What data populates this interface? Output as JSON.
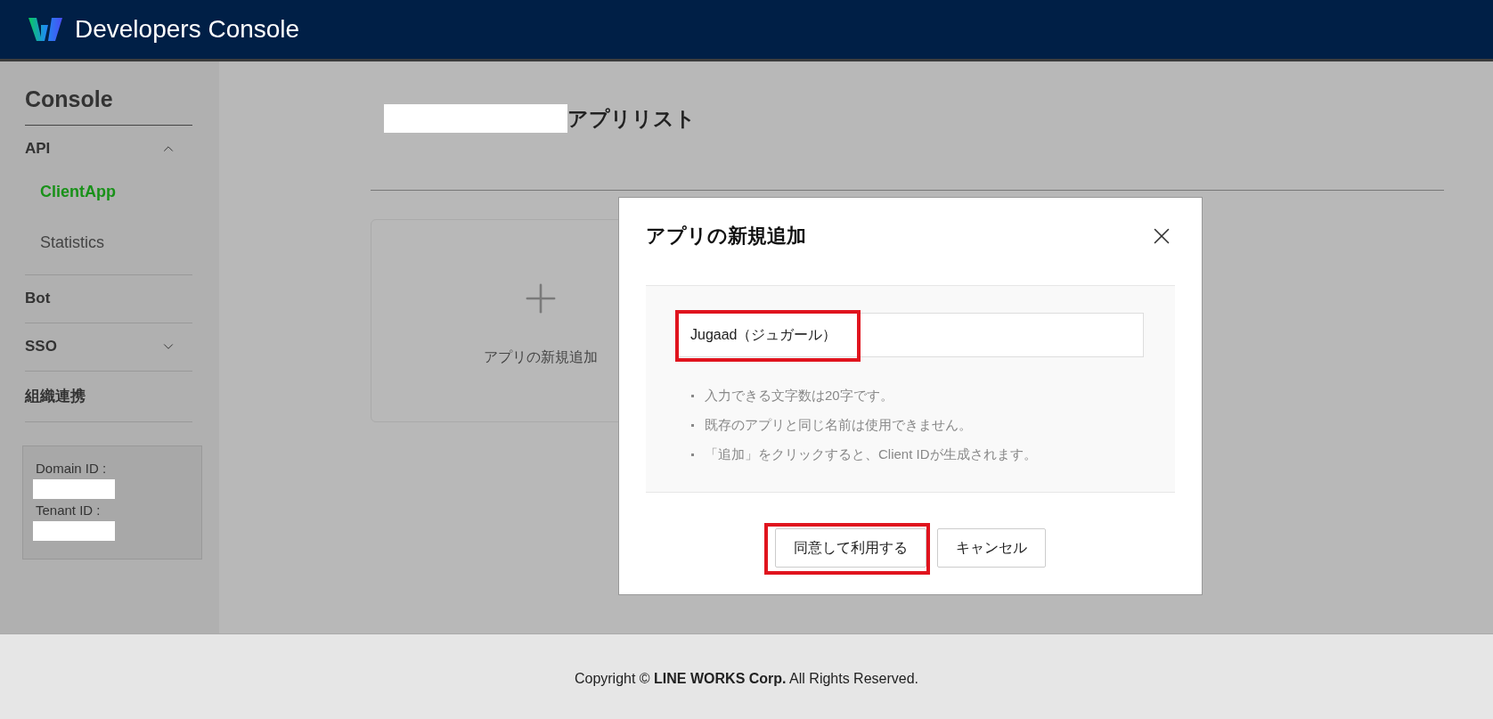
{
  "header": {
    "title": "Developers Console"
  },
  "sidebar": {
    "title": "Console",
    "items": [
      {
        "label": "API",
        "expanded": true,
        "children": [
          {
            "label": "ClientApp",
            "selected": true
          },
          {
            "label": "Statistics",
            "selected": false
          }
        ]
      },
      {
        "label": "Bot"
      },
      {
        "label": "SSO",
        "expanded": false
      },
      {
        "label": "組織連携"
      }
    ],
    "info": [
      {
        "label": "Domain ID :"
      },
      {
        "label": "Tenant ID :"
      }
    ]
  },
  "page": {
    "title": "アプリリスト",
    "add_card": {
      "label": "アプリの新規追加"
    }
  },
  "dialog": {
    "title": "アプリの新規追加",
    "name_field": {
      "value": "Jugaad（ジュガール）",
      "highlighted": true
    },
    "notes": [
      "入力できる文字数は20字です。",
      "既存のアプリと同じ名前は使用できません。",
      "「追加」をクリックすると、Client IDが生成されます。"
    ],
    "buttons": [
      {
        "label": "同意して利用する",
        "highlighted": true
      },
      {
        "label": "キャンセル",
        "highlighted": false
      }
    ]
  },
  "footer": {
    "text": "Copyright © **LINE WORKS Corp.** All Rights Reserved."
  }
}
